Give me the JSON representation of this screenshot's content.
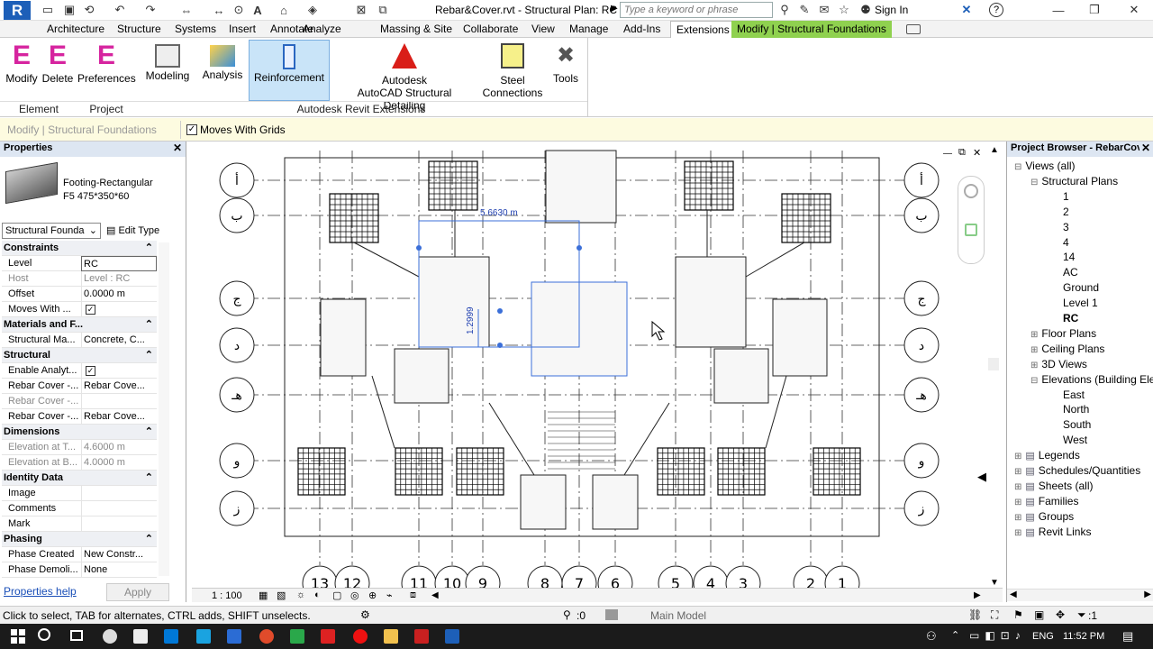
{
  "title": {
    "doc_title": "Rebar&Cover.rvt - Structural Plan: RC",
    "search_placeholder": "Type a keyword or phrase",
    "sign_in": "Sign In",
    "help": "?"
  },
  "ribbon_tabs": [
    "Architecture",
    "Structure",
    "Systems",
    "Insert",
    "Annotate",
    "Analyze",
    "Massing & Site",
    "Collaborate",
    "View",
    "Manage",
    "Add-Ins",
    "Extensions",
    "Modify | Structural Foundations"
  ],
  "ribbon": {
    "modify": "Modify",
    "delete": "Delete",
    "preferences": "Preferences",
    "modeling": "Modeling",
    "analysis": "Analysis",
    "reinforcement": "Reinforcement",
    "autodesk_l1": "Autodesk",
    "autodesk_l2": "AutoCAD Structural Detailing",
    "steel_l1": "Steel",
    "steel_l2": "Connections",
    "tools": "Tools",
    "panel_element": "Element",
    "panel_project": "Project",
    "panel_extensions": "Autodesk Revit Extensions"
  },
  "optbar": {
    "context": "Modify | Structural Foundations",
    "moves_with_grids": "Moves With Grids"
  },
  "properties": {
    "header": "Properties",
    "type_name_1": "Footing-Rectangular",
    "type_name_2": "F5 475*350*60",
    "category_select": "Structural Founda",
    "edit_type": "Edit Type",
    "rows": [
      {
        "k": "Constraints",
        "group": true
      },
      {
        "k": "Level",
        "v": "RC"
      },
      {
        "k": "Host",
        "v": "Level : RC",
        "dim": true
      },
      {
        "k": "Offset",
        "v": "0.0000 m"
      },
      {
        "k": "Moves With ...",
        "check": true
      },
      {
        "k": "Materials and F...",
        "group": true
      },
      {
        "k": "Structural Ma...",
        "v": "Concrete, C..."
      },
      {
        "k": "Structural",
        "group": true
      },
      {
        "k": "Enable Analyt...",
        "check": true
      },
      {
        "k": "Rebar Cover -...",
        "v": "Rebar Cove..."
      },
      {
        "k": "Rebar Cover -...",
        "v": "",
        "dim": true
      },
      {
        "k": "Rebar Cover -...",
        "v": "Rebar Cove..."
      },
      {
        "k": "Dimensions",
        "group": true
      },
      {
        "k": "Elevation at T...",
        "v": "4.6000 m",
        "dim": true
      },
      {
        "k": "Elevation at B...",
        "v": "4.0000 m",
        "dim": true
      },
      {
        "k": "Identity Data",
        "group": true
      },
      {
        "k": "Image",
        "v": ""
      },
      {
        "k": "Comments",
        "v": ""
      },
      {
        "k": "Mark",
        "v": ""
      },
      {
        "k": "Phasing",
        "group": true
      },
      {
        "k": "Phase Created",
        "v": "New Constr..."
      },
      {
        "k": "Phase Demoli...",
        "v": "None"
      }
    ],
    "help_link": "Properties help",
    "apply": "Apply"
  },
  "canvas": {
    "dim_horizontal": "5.6630 m",
    "dim_vertical": "1.2999",
    "scale": "1 : 100",
    "grid_bottom": [
      "13",
      "12",
      "11",
      "10",
      "9",
      "8",
      "7",
      "6",
      "5",
      "4",
      "3",
      "2",
      "1"
    ],
    "grid_left": [
      "أ",
      "ب",
      "ج",
      "د",
      "هـ",
      "و",
      "ز"
    ],
    "grid_right": [
      "أ",
      "ب",
      "ج",
      "د",
      "هـ",
      "و",
      "ز"
    ]
  },
  "browser": {
    "header": "Project Browser - RebarCov...",
    "nodes": [
      {
        "label": "Views (all)",
        "lvl": 0,
        "bold": false
      },
      {
        "label": "Structural Plans",
        "lvl": 1
      },
      {
        "label": "1",
        "lvl": 2
      },
      {
        "label": "2",
        "lvl": 2
      },
      {
        "label": "3",
        "lvl": 2
      },
      {
        "label": "4",
        "lvl": 2
      },
      {
        "label": "14",
        "lvl": 2
      },
      {
        "label": "AC",
        "lvl": 2
      },
      {
        "label": "Ground",
        "lvl": 2
      },
      {
        "label": "Level 1",
        "lvl": 2
      },
      {
        "label": "RC",
        "lvl": 2,
        "bold": true
      },
      {
        "label": "Floor Plans",
        "lvl": 1
      },
      {
        "label": "Ceiling Plans",
        "lvl": 1
      },
      {
        "label": "3D Views",
        "lvl": 1
      },
      {
        "label": "Elevations (Building Elev",
        "lvl": 1
      },
      {
        "label": "East",
        "lvl": 2
      },
      {
        "label": "North",
        "lvl": 2
      },
      {
        "label": "South",
        "lvl": 2
      },
      {
        "label": "West",
        "lvl": 2
      },
      {
        "label": "Legends",
        "lvl": 0
      },
      {
        "label": "Schedules/Quantities",
        "lvl": 0
      },
      {
        "label": "Sheets (all)",
        "lvl": 0
      },
      {
        "label": "Families",
        "lvl": 0
      },
      {
        "label": "Groups",
        "lvl": 0
      },
      {
        "label": "Revit Links",
        "lvl": 0
      }
    ]
  },
  "status": {
    "text": "Click to select, TAB for alternates, CTRL adds, SHIFT unselects.",
    "count": ":0",
    "model": "Main Model",
    "filter": ":1"
  },
  "taskbar": {
    "lang": "ENG",
    "time": "11:52 PM"
  }
}
